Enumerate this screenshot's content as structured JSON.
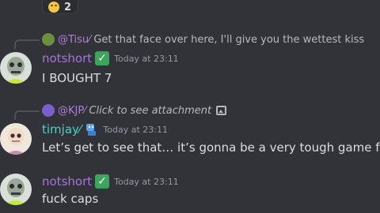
{
  "reaction": {
    "emoji_icon": "grinning-sweat-emoji",
    "count": "2"
  },
  "messages": [
    {
      "reply": {
        "avatar_color": "#6b8f3c",
        "name": "@Tisu⁄",
        "name_color": "#b07fdc",
        "text": "Get that face over here, I'll give you the wettest kiss"
      },
      "author": {
        "name": "notshort",
        "color": "#a574d9",
        "badge": "check-mark-icon",
        "avatar": "zombie-avatar"
      },
      "timestamp": "Today at 23:11",
      "content": "I BOUGHT 7"
    },
    {
      "reply": {
        "avatar_color": "#7a5fd0",
        "name": "@KJP⁄",
        "name_color": "#b07fdc",
        "text": "Click to see attachment",
        "attachment_icon": "image-icon"
      },
      "author": {
        "name": "timjay⁄",
        "color": "#44d4c8",
        "badge": "robot-icon",
        "avatar": "skeleton-avatar"
      },
      "timestamp": "Today at 23:11",
      "content": "Let’s get to see that… it’s gonna be a very tough game for England"
    },
    {
      "author": {
        "name": "notshort",
        "color": "#a574d9",
        "badge": "check-mark-icon",
        "avatar": "zombie-avatar"
      },
      "timestamp": "Today at 23:11",
      "content": "fuck caps"
    }
  ]
}
